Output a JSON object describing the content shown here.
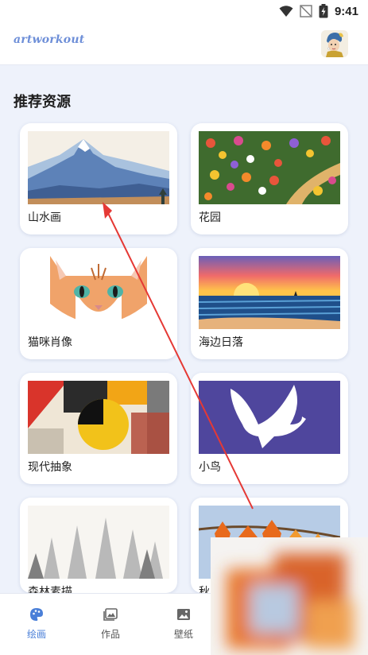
{
  "status_bar": {
    "time": "9:41",
    "icons": [
      "wifi-icon",
      "no-signal-icon",
      "battery-icon"
    ]
  },
  "header": {
    "logo_text": "artworkout",
    "avatar_icon": "girl-with-pearl-earring-avatar"
  },
  "section": {
    "title": "推荐资源"
  },
  "cards": [
    {
      "label": "山水画",
      "icon": "mountain-landscape"
    },
    {
      "label": "花园",
      "icon": "flower-garden"
    },
    {
      "label": "猫咪肖像",
      "icon": "cat-portrait"
    },
    {
      "label": "海边日落",
      "icon": "seaside-sunset"
    },
    {
      "label": "现代抽象",
      "icon": "modern-abstract"
    },
    {
      "label": "小鸟",
      "icon": "bird"
    },
    {
      "label": "森林素描",
      "icon": "forest-sketch"
    },
    {
      "label": "秋",
      "icon": "autumn-leaves"
    }
  ],
  "bottom_nav": {
    "items": [
      {
        "label": "绘画",
        "icon": "palette-icon",
        "active": true
      },
      {
        "label": "作品",
        "icon": "gallery-icon",
        "active": false
      },
      {
        "label": "壁纸",
        "icon": "image-icon",
        "active": false
      }
    ]
  },
  "colors": {
    "accent": "#4a7fd8",
    "background": "#eef2fb",
    "annotation_arrow": "#e53935"
  }
}
